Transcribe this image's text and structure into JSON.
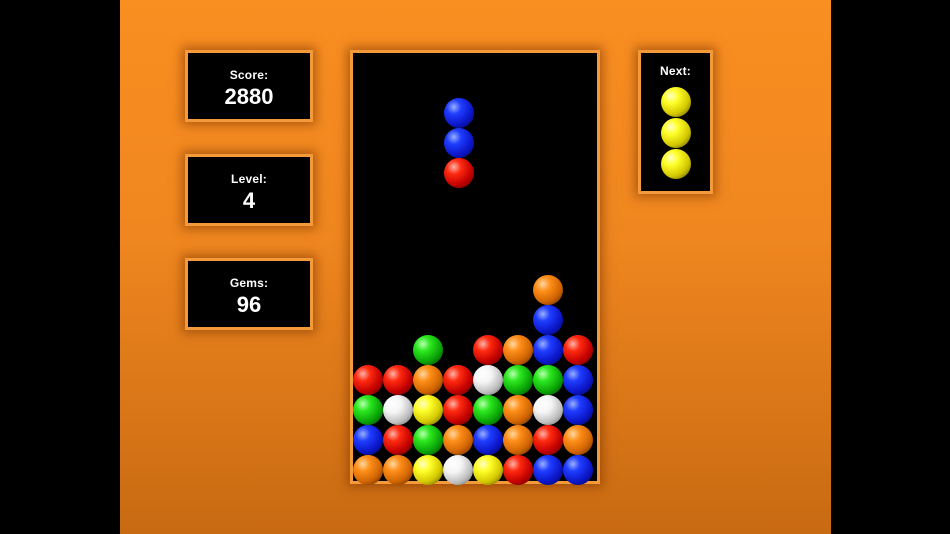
{
  "score": {
    "label": "Score:",
    "value": "2880"
  },
  "level": {
    "label": "Level:",
    "value": "4"
  },
  "gems": {
    "label": "Gems:",
    "value": "96"
  },
  "next": {
    "label": "Next:",
    "pieces": [
      "yellow",
      "yellow",
      "yellow"
    ]
  },
  "board": {
    "columns": 8,
    "rows": 14,
    "falling_piece": {
      "column": 3,
      "top_row": 1,
      "colors": [
        "blue",
        "blue",
        "red"
      ]
    },
    "settled": [
      {
        "row": 7,
        "cells": [
          null,
          null,
          null,
          null,
          null,
          null,
          "orange",
          null
        ]
      },
      {
        "row": 8,
        "cells": [
          null,
          null,
          null,
          null,
          null,
          null,
          "blue",
          null
        ]
      },
      {
        "row": 9,
        "cells": [
          null,
          null,
          "green",
          null,
          "red",
          "orange",
          "blue",
          "red"
        ]
      },
      {
        "row": 10,
        "cells": [
          "red",
          "red",
          "orange",
          "red",
          "white",
          "green",
          "green",
          "blue"
        ]
      },
      {
        "row": 11,
        "cells": [
          "green",
          "white",
          "yellow",
          "red",
          "green",
          "orange",
          "white",
          "blue"
        ]
      },
      {
        "row": 12,
        "cells": [
          "blue",
          "red",
          "green",
          "orange",
          "blue",
          "orange",
          "red",
          "orange"
        ]
      },
      {
        "row": 13,
        "cells": [
          "orange",
          "orange",
          "yellow",
          "white",
          "yellow",
          "red",
          "blue",
          "blue"
        ]
      }
    ]
  },
  "colors": {
    "background_orange": "#f98e21",
    "panel_bg": "#000000",
    "text": "#ffffff"
  }
}
